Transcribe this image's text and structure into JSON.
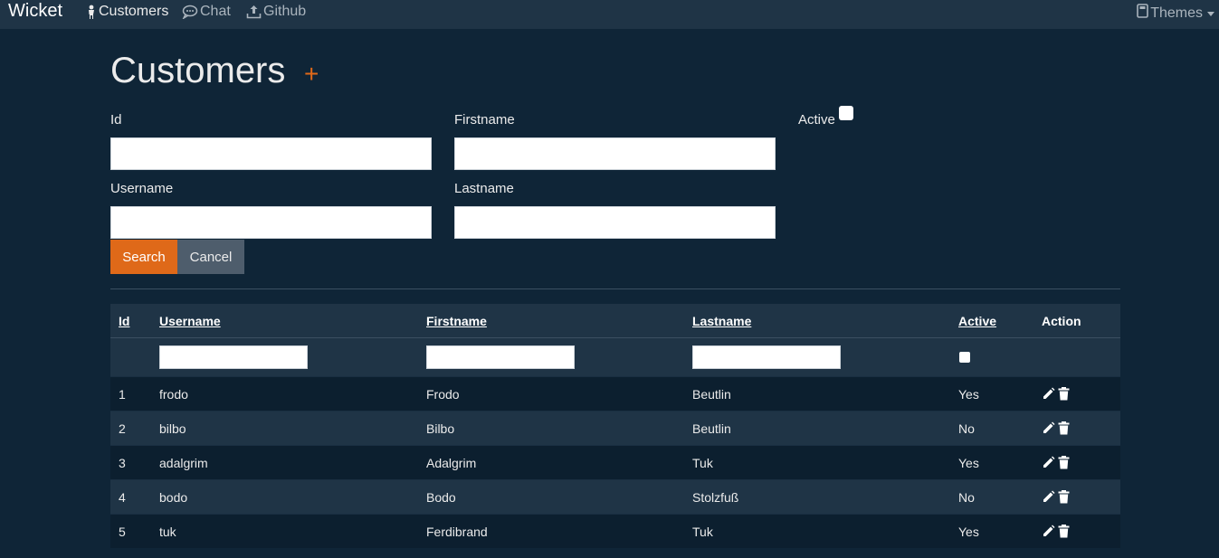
{
  "navbar": {
    "brand": "Wicket",
    "items": [
      {
        "label": "Customers",
        "icon": "person-icon"
      },
      {
        "label": "Chat",
        "icon": "chat-icon"
      },
      {
        "label": "Github",
        "icon": "upload-icon"
      }
    ],
    "themes_label": "Themes",
    "themes_icon": "book-icon"
  },
  "page": {
    "title": "Customers",
    "add_label": "+"
  },
  "filter_form": {
    "id_label": "Id",
    "firstname_label": "Firstname",
    "active_label": "Active",
    "username_label": "Username",
    "lastname_label": "Lastname",
    "id_value": "",
    "firstname_value": "",
    "username_value": "",
    "lastname_value": "",
    "search_label": "Search",
    "cancel_label": "Cancel"
  },
  "table": {
    "columns": [
      "Id",
      "Username",
      "Firstname",
      "Lastname",
      "Active",
      "Action"
    ],
    "rows": [
      {
        "id": "1",
        "username": "frodo",
        "firstname": "Frodo",
        "lastname": "Beutlin",
        "active": "Yes"
      },
      {
        "id": "2",
        "username": "bilbo",
        "firstname": "Bilbo",
        "lastname": "Beutlin",
        "active": "No"
      },
      {
        "id": "3",
        "username": "adalgrim",
        "firstname": "Adalgrim",
        "lastname": "Tuk",
        "active": "Yes"
      },
      {
        "id": "4",
        "username": "bodo",
        "firstname": "Bodo",
        "lastname": "Stolzfuß",
        "active": "No"
      },
      {
        "id": "5",
        "username": "tuk",
        "firstname": "Ferdibrand",
        "lastname": "Tuk",
        "active": "Yes"
      }
    ]
  },
  "colors": {
    "background": "#0f2537",
    "navbar": "#1f3446",
    "accent": "#df6919",
    "secondary": "#4e5d6c"
  }
}
